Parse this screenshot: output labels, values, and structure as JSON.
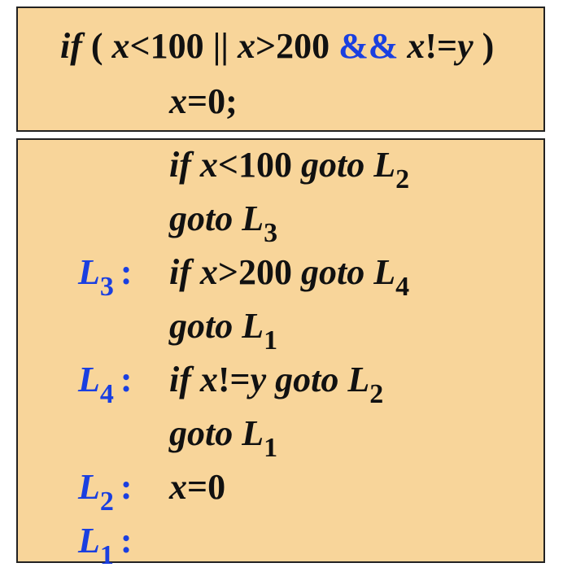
{
  "colors": {
    "box_fill": "#f8d59a",
    "border": "#222222",
    "text": "#111111",
    "accent": "#1a3fe0"
  },
  "source": {
    "line1": {
      "kw_if": "if",
      "open": " ( ",
      "x1": "x",
      "c1": "<100 || ",
      "x2": "x",
      "c2": ">200 ",
      "and": "&&",
      "x3": " x",
      "c3": "!=",
      "y": "y",
      "close": " )"
    },
    "line2": {
      "x": "x",
      "rest": "=0;"
    }
  },
  "target": {
    "rows": [
      {
        "label": "",
        "label_sub": "",
        "code": [
          {
            "t": "if ",
            "s": "i"
          },
          {
            "t": "x",
            "s": "i"
          },
          {
            "t": "<100 ",
            "s": "n"
          },
          {
            "t": "goto L",
            "s": "i"
          },
          {
            "t": "2",
            "s": "sub"
          }
        ]
      },
      {
        "label": "",
        "label_sub": "",
        "code": [
          {
            "t": "goto L",
            "s": "i"
          },
          {
            "t": "3",
            "s": "sub"
          }
        ]
      },
      {
        "label": "L",
        "label_sub": "3",
        "colon": ":",
        "code": [
          {
            "t": "if ",
            "s": "i"
          },
          {
            "t": "x",
            "s": "i"
          },
          {
            "t": ">200 ",
            "s": "n"
          },
          {
            "t": "goto L",
            "s": "i"
          },
          {
            "t": "4",
            "s": "sub"
          }
        ]
      },
      {
        "label": "",
        "label_sub": "",
        "code": [
          {
            "t": "goto L",
            "s": "i"
          },
          {
            "t": "1",
            "s": "sub"
          }
        ]
      },
      {
        "label": "L",
        "label_sub": "4",
        "colon": ":",
        "code": [
          {
            "t": "if ",
            "s": "i"
          },
          {
            "t": "x",
            "s": "i"
          },
          {
            "t": "!=",
            "s": "n"
          },
          {
            "t": "y ",
            "s": "i"
          },
          {
            "t": "goto L",
            "s": "i"
          },
          {
            "t": "2",
            "s": "sub"
          }
        ]
      },
      {
        "label": "",
        "label_sub": "",
        "code": [
          {
            "t": "goto L",
            "s": "i"
          },
          {
            "t": "1",
            "s": "sub"
          }
        ]
      },
      {
        "label": "L",
        "label_sub": "2",
        "colon": ":",
        "code": [
          {
            "t": "x",
            "s": "i"
          },
          {
            "t": "=0",
            "s": "n"
          }
        ]
      },
      {
        "label": "L",
        "label_sub": "1",
        "colon": ":",
        "code": []
      }
    ]
  }
}
